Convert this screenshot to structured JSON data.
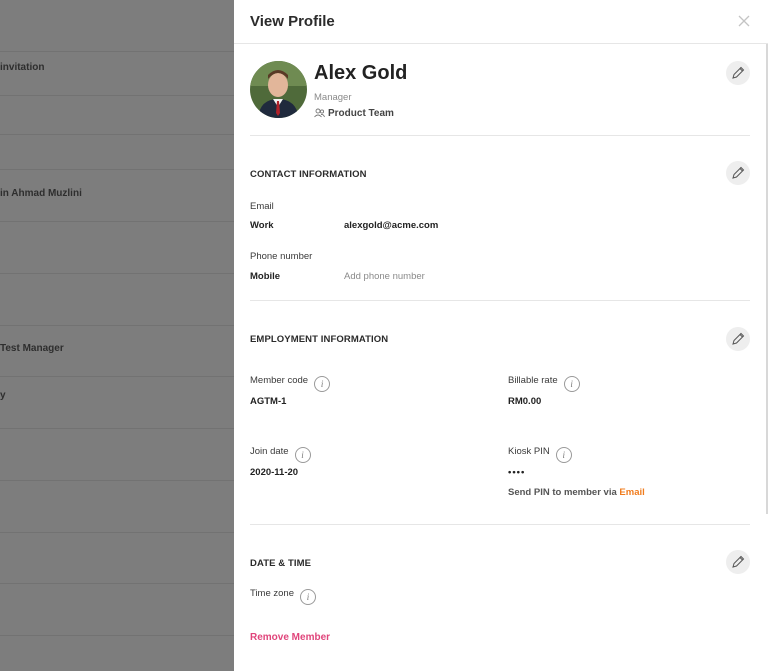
{
  "background": {
    "rows": [
      "",
      "invitation",
      "",
      "",
      "in Ahmad Muzlini",
      "",
      "",
      "Test Manager",
      "y",
      "",
      "",
      "",
      ""
    ]
  },
  "panel": {
    "title": "View Profile",
    "close_icon": "close-icon",
    "profile": {
      "name": "Alex Gold",
      "role": "Manager",
      "team": "Product Team"
    },
    "contact": {
      "title": "CONTACT INFORMATION",
      "email_label": "Email",
      "email_type": "Work",
      "email_value": "alexgold@acme.com",
      "phone_label": "Phone number",
      "phone_type": "Mobile",
      "phone_placeholder": "Add phone number"
    },
    "employment": {
      "title": "EMPLOYMENT INFORMATION",
      "member_code_label": "Member code",
      "member_code": "AGTM-1",
      "billable_rate_label": "Billable rate",
      "billable_rate": "RM0.00",
      "join_date_label": "Join date",
      "join_date": "2020-11-20",
      "kiosk_pin_label": "Kiosk PIN",
      "kiosk_pin": "••••",
      "send_pin_text": "Send PIN to member via",
      "send_pin_link": "Email"
    },
    "datetime": {
      "title": "DATE & TIME",
      "time_zone_label": "Time zone"
    },
    "remove_label": "Remove Member"
  },
  "colors": {
    "accent_orange": "#f07c1e",
    "remove_pink": "#e0457b",
    "overlay": "#7d7d7d"
  }
}
